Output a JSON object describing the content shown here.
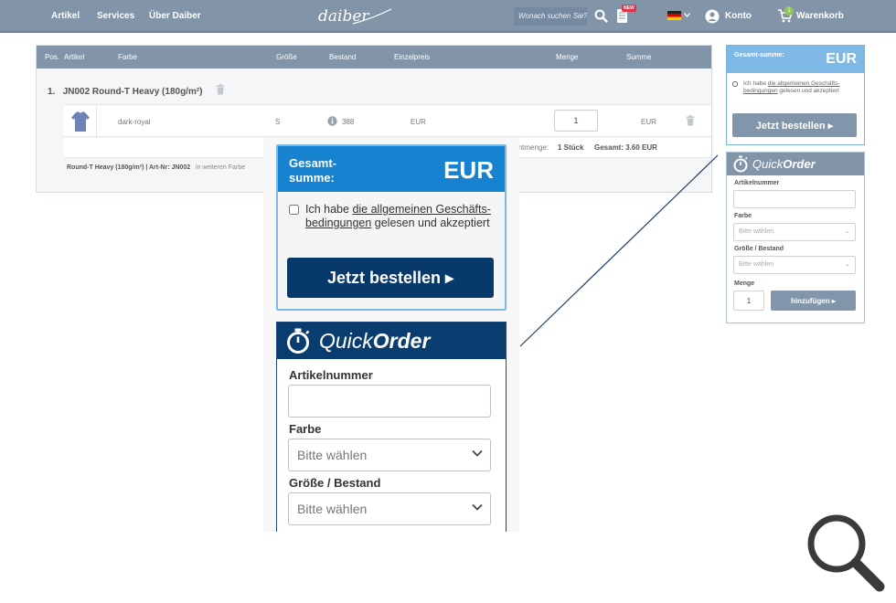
{
  "nav": {
    "links": [
      "Artikel",
      "Services",
      "Über Daiber"
    ],
    "logo_text": "daiber",
    "search_placeholder": "Wonach suchen Sie?",
    "new_badge": "NEW",
    "account_label": "Konto",
    "cart_label": "Warenkorb",
    "cart_count": "1",
    "colors": {
      "bar": "#8194a8",
      "badge": "#e0344a",
      "cart_badge": "#8fc75b"
    },
    "icons": [
      "search-icon",
      "catalog-icon",
      "flag-de-icon",
      "user-icon",
      "cart-icon"
    ]
  },
  "cart": {
    "columns": [
      "Pos.",
      "Artikel",
      "Farbe",
      "Größe",
      "Bestand",
      "Einzelpreis",
      "Menge",
      "Summe"
    ],
    "item": {
      "position": "1.",
      "title": "JN002 Round-T Heavy (180g/m²)",
      "color": "dark-royal",
      "size": "S",
      "stock": "388",
      "unit_price": "EUR",
      "quantity": "1",
      "sum": "EUR"
    },
    "summary_prefix": "amtmenge:",
    "summary_qty": "1 Stück",
    "summary_total": "Gesamt: 3.60 EUR",
    "note_product": "Round-T Heavy (180g/m²) | Art-Nr: JN002",
    "note_more": "in weiteren Farbe"
  },
  "summary": {
    "label": "Gesamt-summe:",
    "value": "EUR",
    "agb_prefix": "Ich habe ",
    "agb_link": "die allgemeinen Geschäfts-bedingungen",
    "agb_suffix": " gelesen und akzeptiert",
    "order_button": "Jetzt bestellen ▸",
    "colors": {
      "head_small": "#7eb9e6",
      "head_zoom": "#1782cf",
      "button_small": "#8195ab",
      "button_zoom": "#07396a"
    }
  },
  "quickorder": {
    "title_light": "Quick",
    "title_bold": "Order",
    "field_article": "Artikelnummer",
    "field_color": "Farbe",
    "field_size": "Größe / Bestand",
    "field_qty": "Menge",
    "select_placeholder": "Bitte wählen",
    "qty_value": "1",
    "add_button": "hinzufügen ▸",
    "colors": {
      "head_small": "#8194a8",
      "head_zoom": "#0a3d6f"
    }
  },
  "zoom": {
    "magnifier_icon": "magnifier-icon"
  }
}
